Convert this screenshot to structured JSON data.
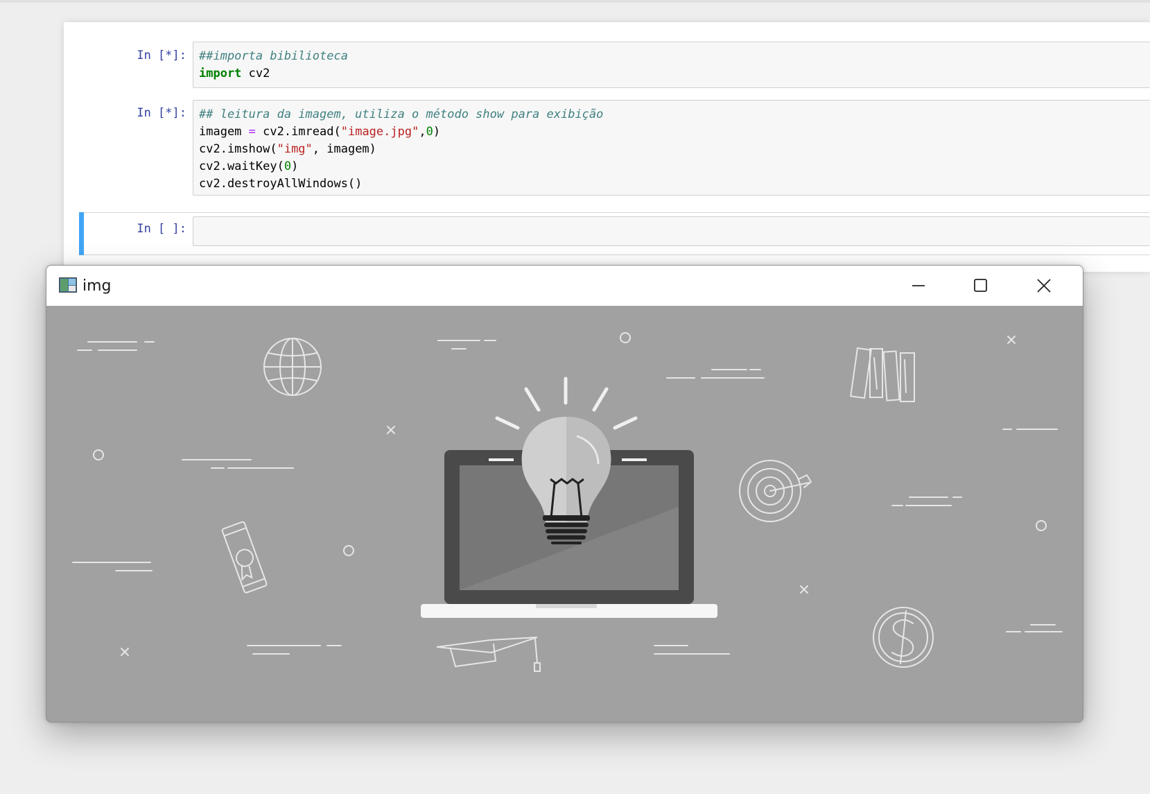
{
  "notebook": {
    "cells": [
      {
        "prompt": "In [*]:",
        "lines": [
          [
            {
              "t": "##importa bibilioteca",
              "c": "cm-comment"
            }
          ],
          [
            {
              "t": "import",
              "c": "cm-keyword"
            },
            {
              "t": " cv2",
              "c": ""
            }
          ]
        ]
      },
      {
        "prompt": "In [*]:",
        "lines": [
          [
            {
              "t": "## leitura da imagem, utiliza o método show para exibição",
              "c": "cm-comment"
            }
          ],
          [
            {
              "t": "imagem ",
              "c": ""
            },
            {
              "t": "=",
              "c": "cm-op"
            },
            {
              "t": " cv2.imread(",
              "c": ""
            },
            {
              "t": "\"image.jpg\"",
              "c": "cm-string"
            },
            {
              "t": ",",
              "c": ""
            },
            {
              "t": "0",
              "c": "cm-number"
            },
            {
              "t": ")",
              "c": ""
            }
          ],
          [
            {
              "t": "cv2.imshow(",
              "c": ""
            },
            {
              "t": "\"img\"",
              "c": "cm-string"
            },
            {
              "t": ", imagem)",
              "c": ""
            }
          ],
          [
            {
              "t": "cv2.waitKey(",
              "c": ""
            },
            {
              "t": "0",
              "c": "cm-number"
            },
            {
              "t": ")",
              "c": ""
            }
          ],
          [
            {
              "t": "cv2.destroyAllWindows()",
              "c": ""
            }
          ]
        ]
      },
      {
        "prompt": "In [ ]:",
        "lines": []
      }
    ]
  },
  "window": {
    "title": "img",
    "icons": [
      "app-icon",
      "minimize-icon",
      "maximize-icon",
      "close-icon"
    ]
  },
  "image": {
    "icons": [
      "globe-icon",
      "lightbulb-icon",
      "laptop-icon",
      "books-icon",
      "target-icon",
      "diploma-icon",
      "graduation-cap-icon",
      "dollar-icon"
    ],
    "colors": {
      "background": "#a1a1a1",
      "laptop": "#4a4a4a",
      "screen": "#777777",
      "bulb": "#d0d0d0",
      "line": "#e8e8e8"
    }
  }
}
